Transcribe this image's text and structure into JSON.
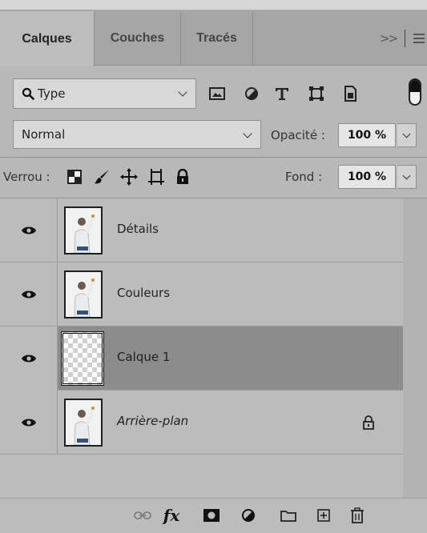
{
  "tabs": [
    {
      "label": "Calques",
      "active": true
    },
    {
      "label": "Couches",
      "active": false
    },
    {
      "label": "Tracés",
      "active": false
    }
  ],
  "tab_menu": {
    "overflow_label": ">>"
  },
  "filter": {
    "selected": "Type",
    "icons": [
      "image-filter-icon",
      "adjustment-filter-icon",
      "text-filter-icon",
      "shape-filter-icon",
      "smart-object-filter-icon"
    ]
  },
  "blend": {
    "mode": "Normal",
    "opacity_label": "Opacité :",
    "opacity_value": "100 %"
  },
  "lock": {
    "label": "Verrou :",
    "fill_label": "Fond :",
    "fill_value": "100 %"
  },
  "layers": [
    {
      "name": "Détails",
      "visible": true,
      "selected": false,
      "thumb": "photo",
      "italic": false,
      "locked": false
    },
    {
      "name": "Couleurs",
      "visible": true,
      "selected": false,
      "thumb": "photo",
      "italic": false,
      "locked": false
    },
    {
      "name": "Calque 1",
      "visible": true,
      "selected": true,
      "thumb": "transparent",
      "italic": false,
      "locked": false
    },
    {
      "name": "Arrière-plan",
      "visible": true,
      "selected": false,
      "thumb": "photo",
      "italic": true,
      "locked": true
    }
  ],
  "bottom_toolbar": {
    "icons": [
      "link-layers-icon",
      "fx-icon",
      "add-mask-icon",
      "adjustment-layer-icon",
      "new-group-icon",
      "new-layer-icon",
      "delete-layer-icon"
    ],
    "fx_label": "fx"
  },
  "colors": {
    "panel_bg": "#bcbcbc",
    "tab_bar": "#a6a6a6",
    "selected_row": "#8c8c8c"
  }
}
